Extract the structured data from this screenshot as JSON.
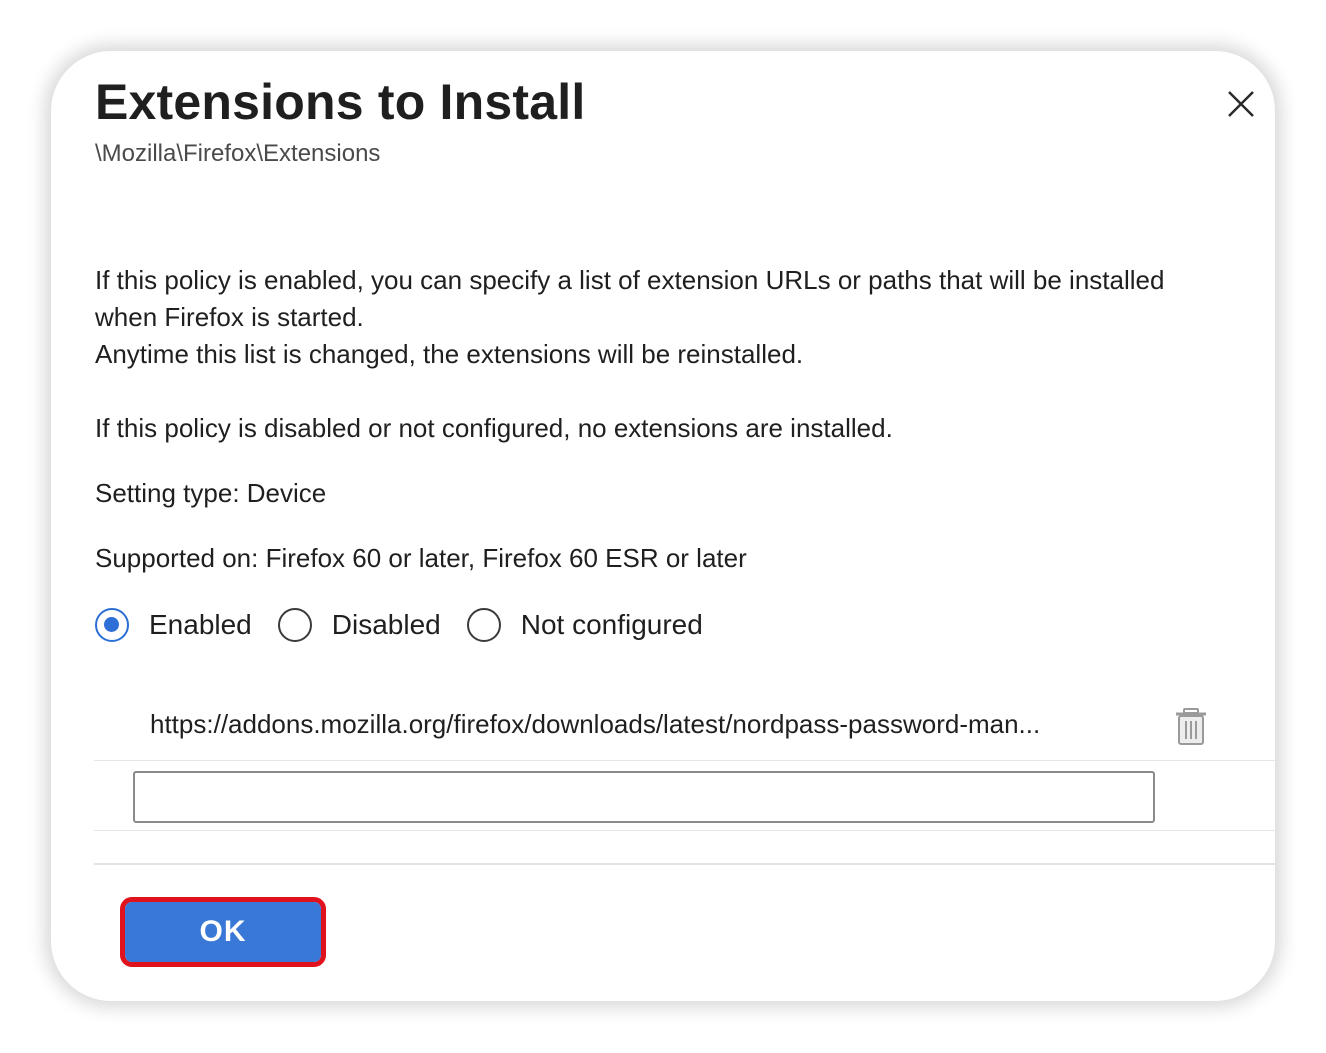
{
  "dialog": {
    "title": "Extensions to Install",
    "path": "\\Mozilla\\Firefox\\Extensions",
    "close_icon": "close-icon"
  },
  "description": {
    "line1": "If this policy is enabled, you can specify a list of extension URLs or paths that will be installed",
    "line2": "when Firefox is started.",
    "line3": "Anytime this list is changed, the extensions will be reinstalled.",
    "line4": "If this policy is disabled or not configured, no extensions are installed.",
    "setting_type": "Setting type: Device",
    "supported_on": "Supported on: Firefox 60 or later, Firefox 60 ESR or later"
  },
  "state": {
    "options": [
      "Enabled",
      "Disabled",
      "Not configured"
    ],
    "selected": "Enabled"
  },
  "extensions": {
    "items": [
      "https://addons.mozilla.org/firefox/downloads/latest/nordpass-password-man..."
    ],
    "new_item_value": "",
    "delete_icon": "trash-icon"
  },
  "footer": {
    "ok_label": "OK"
  },
  "colors": {
    "accent": "#3a78d8",
    "radio_checked": "#2d6fd6",
    "highlight": "#e0121e"
  }
}
